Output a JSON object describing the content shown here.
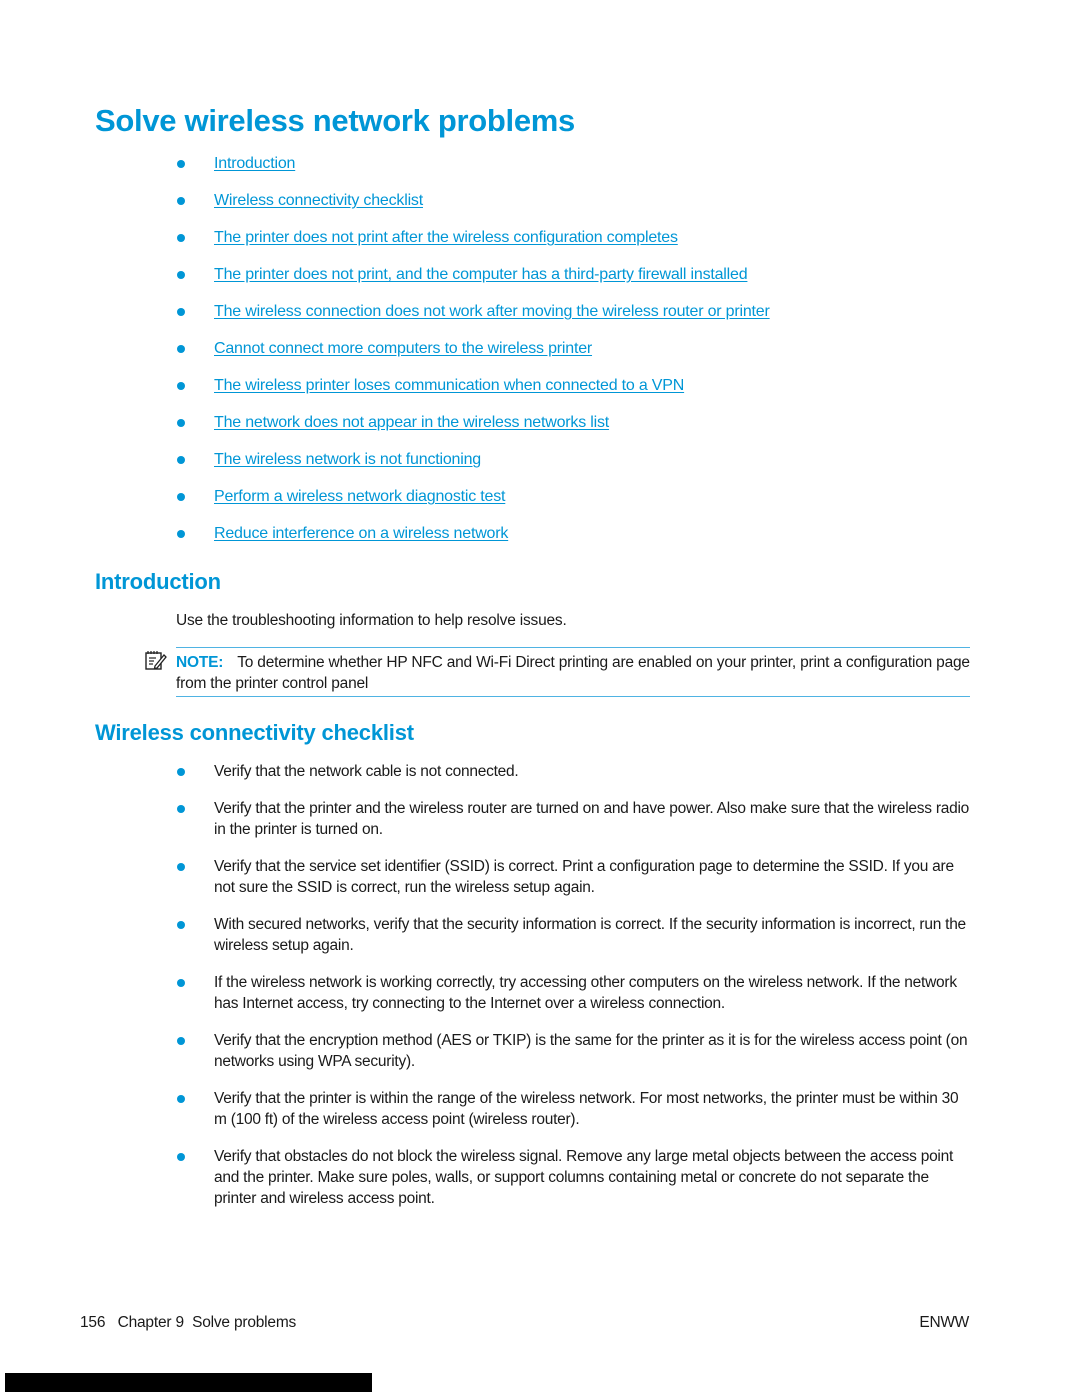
{
  "colors": {
    "accent": "#0096d6",
    "rule": "#4fb3e3",
    "text": "#1a1a1a"
  },
  "page": {
    "title": "Solve wireless network problems"
  },
  "toc": {
    "items": [
      {
        "label": "Introduction"
      },
      {
        "label": "Wireless connectivity checklist"
      },
      {
        "label": "The printer does not print after the wireless configuration completes"
      },
      {
        "label": "The printer does not print, and the computer has a third-party firewall installed"
      },
      {
        "label": "The wireless connection does not work after moving the wireless router or printer"
      },
      {
        "label": "Cannot connect more computers to the wireless printer"
      },
      {
        "label": "The wireless printer loses communication when connected to a VPN"
      },
      {
        "label": "The network does not appear in the wireless networks list"
      },
      {
        "label": "The wireless network is not functioning"
      },
      {
        "label": "Perform a wireless network diagnostic test"
      },
      {
        "label": "Reduce interference on a wireless network"
      }
    ]
  },
  "introduction": {
    "heading": "Introduction",
    "body": "Use the troubleshooting information to help resolve issues.",
    "note": {
      "icon": "note-pencil-icon",
      "label": "NOTE:",
      "text": "To determine whether HP NFC and Wi-Fi Direct printing are enabled on your printer, print a configuration page from the printer control panel"
    }
  },
  "checklist": {
    "heading": "Wireless connectivity checklist",
    "items": [
      {
        "text": "Verify that the network cable is not connected."
      },
      {
        "text": "Verify that the printer and the wireless router are turned on and have power. Also make sure that the wireless radio in the printer is turned on."
      },
      {
        "text": "Verify that the service set identifier (SSID) is correct. Print a configuration page to determine the SSID. If you are not sure the SSID is correct, run the wireless setup again."
      },
      {
        "text": "With secured networks, verify that the security information is correct. If the security information is incorrect, run the wireless setup again."
      },
      {
        "text": "If the wireless network is working correctly, try accessing other computers on the wireless network. If the network has Internet access, try connecting to the Internet over a wireless connection."
      },
      {
        "text": "Verify that the encryption method (AES or TKIP) is the same for the printer as it is for the wireless access point (on networks using WPA security)."
      },
      {
        "text": "Verify that the printer is within the range of the wireless network. For most networks, the printer must be within 30 m (100 ft) of the wireless access point (wireless router)."
      },
      {
        "text": "Verify that obstacles do not block the wireless signal. Remove any large metal objects between the access point and the printer. Make sure poles, walls, or support columns containing metal or concrete do not separate the printer and wireless access point."
      }
    ]
  },
  "footer": {
    "page_number": "156",
    "chapter": "Chapter 9  Solve problems",
    "locale": "ENWW"
  }
}
